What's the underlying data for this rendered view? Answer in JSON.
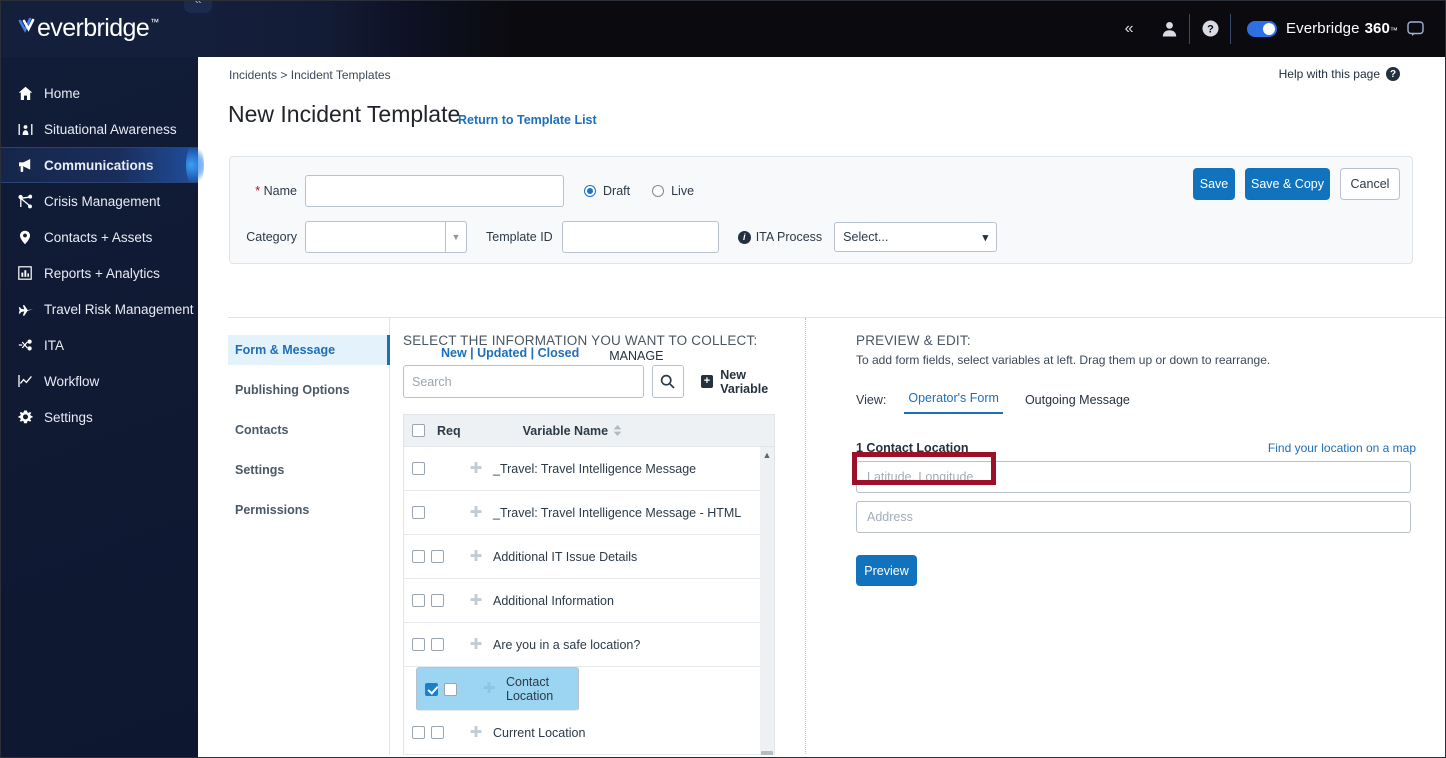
{
  "topbar": {
    "logo_text": "everbridge",
    "logo_tm": "™",
    "collapse_icon": "chevrons-left-icon",
    "collapse_label": "«",
    "user_icon": "user-icon",
    "help_icon": "help-circle-icon",
    "toggle_on": true,
    "brand_prefix": "Everbridge",
    "brand_bold": "360",
    "brand_tm": "™",
    "chat_icon": "chat-icon"
  },
  "sidebar": {
    "items": [
      {
        "label": "Home",
        "icon": "home-icon",
        "active": false
      },
      {
        "label": "Situational Awareness",
        "icon": "situational-awareness-icon",
        "active": false
      },
      {
        "label": "Communications",
        "icon": "megaphone-icon",
        "active": true
      },
      {
        "label": "Crisis Management",
        "icon": "crisis-management-icon",
        "active": false
      },
      {
        "label": "Contacts + Assets",
        "icon": "map-pin-icon",
        "active": false
      },
      {
        "label": "Reports + Analytics",
        "icon": "bar-chart-icon",
        "active": false
      },
      {
        "label": "Travel Risk Management",
        "icon": "airplane-icon",
        "active": false
      },
      {
        "label": "ITA",
        "icon": "ita-icon",
        "active": false
      },
      {
        "label": "Workflow",
        "icon": "workflow-chart-icon",
        "active": false
      },
      {
        "label": "Settings",
        "icon": "gear-icon",
        "active": false
      }
    ]
  },
  "page": {
    "breadcrumb_parent": "Incidents",
    "breadcrumb_sep": ">",
    "breadcrumb_current": "Incident Templates",
    "title": "New Incident Template",
    "return_link": "Return to Template List",
    "help_text": "Help with this page",
    "help_icon": "question-mark-icon"
  },
  "form_header": {
    "name_required_mark": "*",
    "name_label": "Name",
    "name_value": "",
    "name_placeholder": "",
    "status_options": [
      {
        "label": "Draft",
        "selected": true
      },
      {
        "label": "Live",
        "selected": false
      }
    ],
    "category_label": "Category",
    "category_value": "",
    "category_dropdown_icon": "caret-down-icon",
    "template_id_label": "Template ID",
    "template_id_value": "",
    "ita_process_label": "ITA Process",
    "ita_info_icon": "info-icon",
    "ita_process_value": "Select...",
    "ita_process_caret": "chevron-down-icon",
    "buttons": {
      "save": "Save",
      "save_copy": "Save & Copy",
      "cancel": "Cancel"
    },
    "accent_color": "#1173bd"
  },
  "tabs": [
    {
      "label": "New | Updated | Closed",
      "active": true
    },
    {
      "label": "MANAGE",
      "active": false
    }
  ],
  "subnav": {
    "items": [
      {
        "label": "Form & Message",
        "active": true
      },
      {
        "label": "Publishing Options",
        "active": false
      },
      {
        "label": "Contacts",
        "active": false
      },
      {
        "label": "Settings",
        "active": false
      },
      {
        "label": "Permissions",
        "active": false
      }
    ]
  },
  "center": {
    "section_title": "SELECT THE INFORMATION YOU WANT TO COLLECT:",
    "search_placeholder": "Search",
    "search_value": "",
    "search_icon": "search-icon",
    "new_variable_label": "New Variable",
    "new_variable_icon": "plus-square-icon",
    "table": {
      "header_checkbox_checked": false,
      "col_req": "Req",
      "col_variable": "Variable Name",
      "sort_icon": "sort-icon",
      "rows": [
        {
          "name": "_Travel: Travel Intelligence Message",
          "selected": false,
          "has_req": false,
          "checked": false,
          "req_checked": false
        },
        {
          "name": "_Travel: Travel Intelligence Message - HTML",
          "selected": false,
          "has_req": false,
          "checked": false,
          "req_checked": false
        },
        {
          "name": "Additional IT Issue Details",
          "selected": false,
          "has_req": true,
          "checked": false,
          "req_checked": false
        },
        {
          "name": "Additional Information",
          "selected": false,
          "has_req": true,
          "checked": false,
          "req_checked": false
        },
        {
          "name": "Are you in a safe location?",
          "selected": false,
          "has_req": true,
          "checked": false,
          "req_checked": false
        },
        {
          "name": "Contact Location",
          "selected": true,
          "has_req": true,
          "checked": true,
          "req_checked": false
        },
        {
          "name": "Current Location",
          "selected": false,
          "has_req": true,
          "checked": false,
          "req_checked": false
        }
      ]
    },
    "scroll_up_icon": "scroll-up-arrow-icon"
  },
  "preview": {
    "title": "PREVIEW & EDIT:",
    "subtitle": "To add form fields, select variables at left. Drag them up or down to rearrange.",
    "view_label": "View:",
    "view_tabs": [
      {
        "label": "Operator's Form",
        "active": true
      },
      {
        "label": "Outgoing Message",
        "active": false
      }
    ],
    "field_number": "1",
    "field_label": "1 Contact Location",
    "map_link": "Find your location on a map",
    "lat_long_placeholder": "Latitude, Longitude",
    "lat_long_value": "",
    "address_placeholder": "Address",
    "address_value": "",
    "preview_button": "Preview"
  },
  "annotation": {
    "color": "#9c1127",
    "target": "latitude-longitude-input"
  }
}
